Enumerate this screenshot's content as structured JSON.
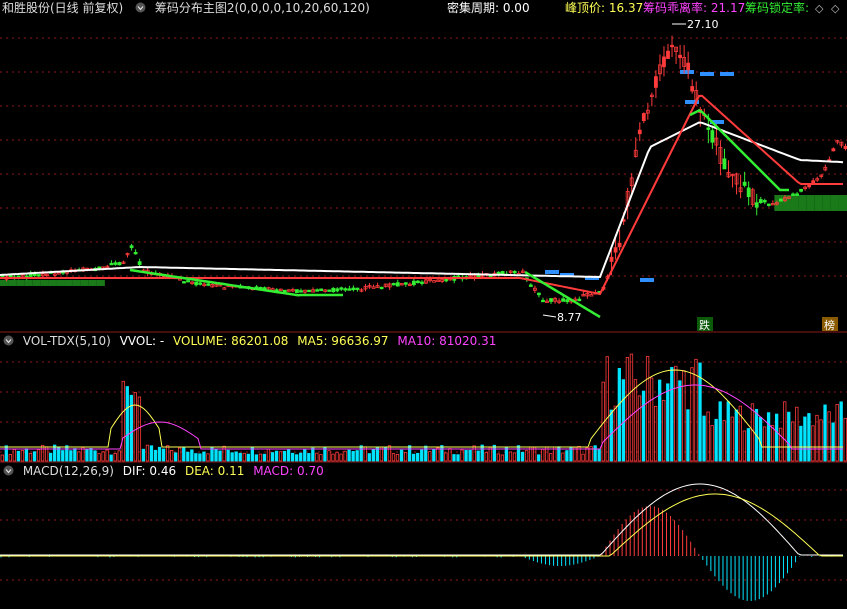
{
  "colors": {
    "up": "#ff3b3b",
    "down": "#00e5ff",
    "white": "#ffffff",
    "yellow": "#ffff55",
    "magenta": "#ff44ff",
    "green": "#33ee33",
    "blue": "#2f8fff",
    "grid": "#8b1a1a"
  },
  "main": {
    "stock_title": "和胜股份(日线 前复权)",
    "indicator_title": "筹码分布主图2(0,0,0,0,10,20,60,120)",
    "dense_label": "密集周期: 0.00",
    "peak_label": "峰顶价: 16.37",
    "divergence_label": "筹码乖离率: 21.17",
    "lock_label": "筹码锁定率:",
    "high_price": "27.10",
    "low_price": "8.77",
    "tag_die": "跌",
    "tag_bang": "榜"
  },
  "vol": {
    "title": "VOL-TDX(5,10)",
    "vvol": "VVOL: -",
    "volume": "VOLUME: 86201.08",
    "ma5": "MA5: 96636.97",
    "ma10": "MA10: 81020.31"
  },
  "macd": {
    "title": "MACD(12,26,9)",
    "dif": "DIF: 0.46",
    "dea": "DEA: 0.11",
    "macd": "MACD: 0.70"
  },
  "chart_data": {
    "type": "candlestick",
    "price_high": 27.1,
    "price_low": 8.77,
    "peak_price": 16.37,
    "last_volume": 86201.08,
    "vol_ma5": 96636.97,
    "vol_ma10": 81020.31,
    "dif": 0.46,
    "dea": 0.11,
    "macd": 0.7
  }
}
